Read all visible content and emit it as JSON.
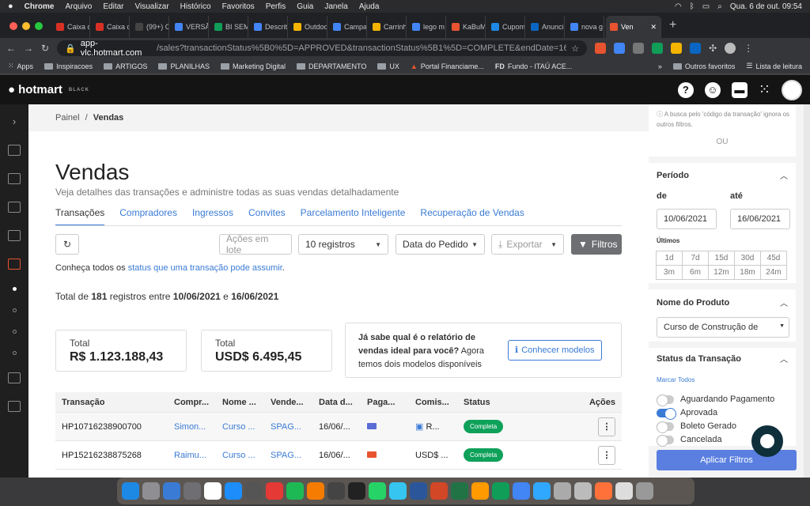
{
  "menubar": {
    "apple": "",
    "items": [
      "Chrome",
      "Arquivo",
      "Editar",
      "Visualizar",
      "Histórico",
      "Favoritos",
      "Perfis",
      "Guia",
      "Janela",
      "Ajuda"
    ],
    "clock": "Qua. 6 de out.  09:54"
  },
  "tabs": [
    {
      "label": "Caixa d",
      "color": "#d93025"
    },
    {
      "label": "Caixa d",
      "color": "#d93025"
    },
    {
      "label": "(99+) C",
      "color": "#444"
    },
    {
      "label": "VERSÃ",
      "color": "#4285f4"
    },
    {
      "label": "BI SEM",
      "color": "#0f9d58"
    },
    {
      "label": "Descrit",
      "color": "#4285f4"
    },
    {
      "label": "Outdoo",
      "color": "#f4b400"
    },
    {
      "label": "Campa",
      "color": "#4285f4"
    },
    {
      "label": "Carrinh",
      "color": "#f4b400"
    },
    {
      "label": "lego m",
      "color": "#4285f4"
    },
    {
      "label": "KaBuM",
      "color": "#e8542f"
    },
    {
      "label": "Cupom",
      "color": "#1e88e5"
    },
    {
      "label": "Anunci",
      "color": "#0a66c2"
    },
    {
      "label": "nova g",
      "color": "#4285f4"
    },
    {
      "label": "Ven",
      "color": "#e8542f",
      "active": true
    }
  ],
  "omnibox": {
    "host": "app-vlc.hotmart.com",
    "path": "/sales?transactionStatus%5B0%5D=APPROVED&transactionStatus%5B1%5D=COMPLETE&endDate=162381240..."
  },
  "bookmarks": [
    "Apps",
    "Inspiracoes",
    "ARTIGOS",
    "PLANILHAS",
    "Marketing Digital",
    "DEPARTAMENTO",
    "UX",
    "Portal Financiame...",
    "Fundo - ITAÚ ACE...",
    "Outros favoritos",
    "Lista de leitura"
  ],
  "hotmart": {
    "logo": "hotmart",
    "tier": "BLACK"
  },
  "breadcrumb": {
    "root": "Painel",
    "sep": "/",
    "current": "Vendas"
  },
  "page": {
    "title": "Vendas",
    "subtitle": "Veja detalhes das transações e administre todas as suas vendas detalhadamente"
  },
  "nav_tabs": [
    "Transações",
    "Compradores",
    "Ingressos",
    "Convites",
    "Parcelamento Inteligente",
    "Recuperação de Vendas"
  ],
  "toolbar": {
    "bulk": "Ações em lote",
    "records": "10 registros",
    "order": "Data do Pedido",
    "export": "Exportar",
    "filters": "Filtros"
  },
  "help": {
    "prefix": "Conheça todos os ",
    "link": "status que uma transação pode assumir",
    "suffix": "."
  },
  "total_line": {
    "prefix": "Total de ",
    "count": "181",
    "mid": " registros entre ",
    "start": "10/06/2021",
    "and": " e ",
    "end": "16/06/2021"
  },
  "cards": [
    {
      "label": "Total",
      "value": "R$ 1.123.188,43"
    },
    {
      "label": "Total",
      "value": "USD$ 6.495,45"
    }
  ],
  "promo": {
    "question": "Já sabe qual é o relatório de vendas ideal para você?",
    "text": " Agora temos dois modelos disponíveis",
    "button": "Conhecer modelos"
  },
  "table": {
    "headers": [
      "Transação",
      "Compr...",
      "Nome ...",
      "Vende...",
      "Data d...",
      "Paga...",
      "Comis...",
      "Status",
      "Ações"
    ],
    "rows": [
      {
        "id": "HP10716238900700",
        "buyer": "Simon...",
        "product": "Curso ...",
        "seller": "SPAG...",
        "date": "16/06/...",
        "commission": "R...",
        "status": "Completa"
      },
      {
        "id": "HP15216238875268",
        "buyer": "Raimu...",
        "product": "Curso ...",
        "seller": "SPAG...",
        "date": "16/06/...",
        "commission": "USD$ ...",
        "status": "Completa"
      }
    ]
  },
  "panel": {
    "note": "A busca pelo 'código da transação' ignora os outros filtros.",
    "or": "OU",
    "period": {
      "title": "Período",
      "from_label": "de",
      "to_label": "até",
      "from": "10/06/2021",
      "to": "16/06/2021",
      "last": "Últimos",
      "ranges": [
        "1d",
        "7d",
        "15d",
        "30d",
        "45d",
        "3m",
        "6m",
        "12m",
        "18m",
        "24m"
      ]
    },
    "product": {
      "title": "Nome do Produto",
      "value": "Curso de Construção de"
    },
    "status": {
      "title": "Status da Transação",
      "mark_all": "Marcar Todos",
      "options": [
        {
          "label": "Aguardando Pagamento",
          "on": false
        },
        {
          "label": "Aprovada",
          "on": true
        },
        {
          "label": "Boleto Gerado",
          "on": false
        },
        {
          "label": "Cancelada",
          "on": false
        }
      ]
    },
    "apply": "Aplicar Filtros"
  },
  "colors": {
    "accent": "#3a7bd5",
    "success": "#0ea15a",
    "header": "#141414",
    "brand_orange": "#e8542f"
  }
}
